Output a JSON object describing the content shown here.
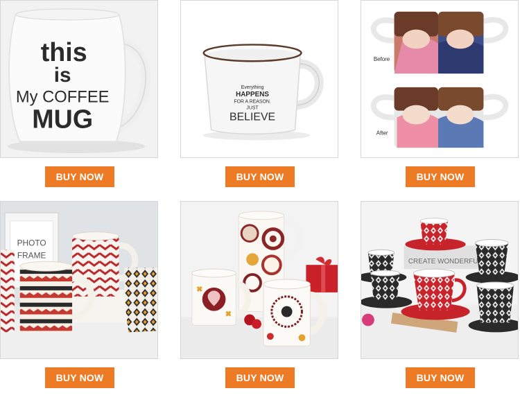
{
  "products": [
    {
      "buy_label": "BUY NOW",
      "print_lines": [
        "this",
        "is",
        "My COFFEE",
        "MUG"
      ]
    },
    {
      "buy_label": "BUY NOW",
      "print_lines": [
        "Everything",
        "HAPPENS",
        "FOR A REASON.",
        "JUST",
        "BELIEVE"
      ]
    },
    {
      "buy_label": "BUY NOW",
      "labels": [
        "Before",
        "After"
      ]
    },
    {
      "buy_label": "BUY NOW",
      "frame_text": [
        "PHOTO",
        "FRAME"
      ]
    },
    {
      "buy_label": "BUY NOW"
    },
    {
      "buy_label": "BUY NOW",
      "box_text": "CREATE WONDERFUL"
    }
  ],
  "colors": {
    "button": "#ed7a25",
    "button_text": "#ffffff",
    "tile_border": "#d6d6d6"
  }
}
